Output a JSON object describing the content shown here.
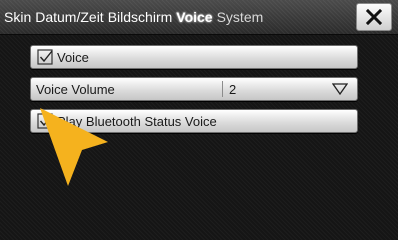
{
  "tabs": [
    {
      "label": "Skin",
      "active": false
    },
    {
      "label": "Datum/Zeit",
      "active": false
    },
    {
      "label": "Bildschirm",
      "active": false
    },
    {
      "label": "Voice",
      "active": true
    },
    {
      "label": "System",
      "active": false
    }
  ],
  "close_icon": "close-icon",
  "settings": {
    "voice_toggle": {
      "label": "Voice",
      "checked": true,
      "icon": "checkbox-checked-icon"
    },
    "voice_volume": {
      "label": "Voice Volume",
      "value": "2",
      "icon": "triangle-down-icon"
    },
    "bluetooth_voice": {
      "label": "Play Bluetooth Status Voice",
      "checked": true,
      "icon": "checkbox-checked-icon"
    }
  },
  "colors": {
    "pointer": "#f5b21e",
    "background": "#151515"
  }
}
